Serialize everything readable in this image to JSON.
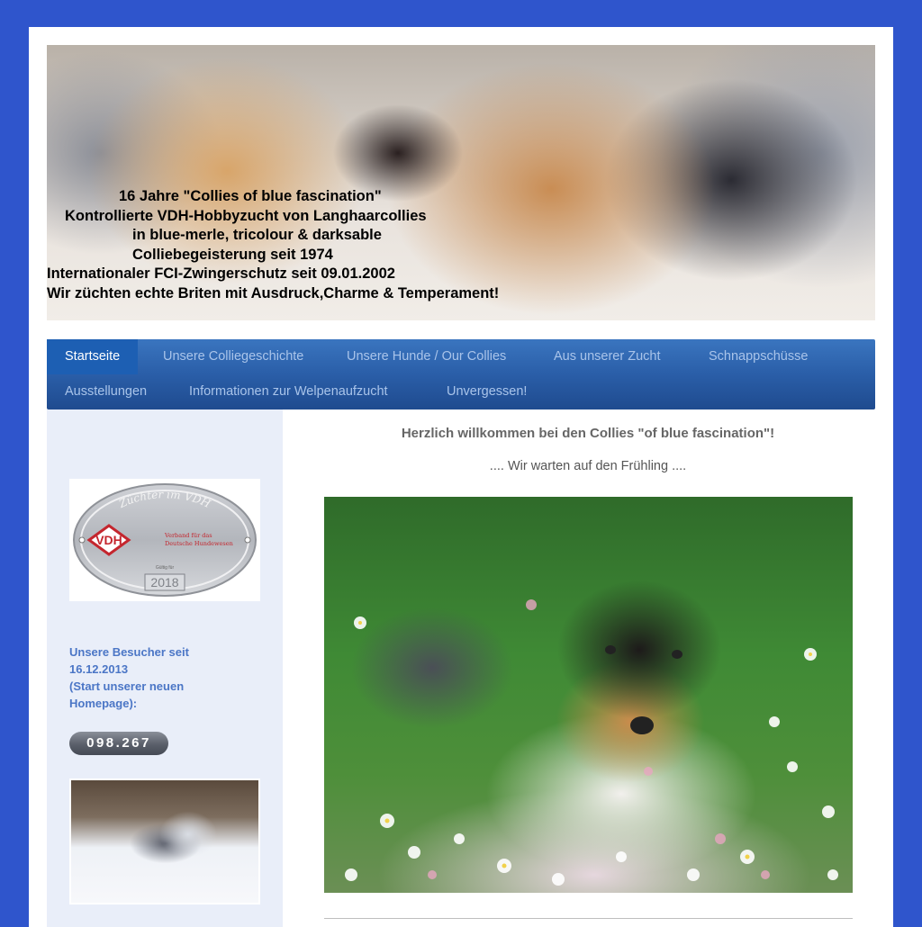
{
  "banner": {
    "lines": [
      "16 Jahre \"Collies of blue fascination\"",
      "Kontrollierte VDH-Hobbyzucht von Langhaarcollies",
      "in blue-merle, tricolour & darksable",
      "Colliebegeisterung seit 1974",
      "Internationaler FCI-Zwingerschutz seit 09.01.2002",
      "Wir züchten echte Briten mit Ausdruck,Charme & Temperament!"
    ]
  },
  "nav": {
    "items": [
      {
        "label": "Startseite",
        "active": true
      },
      {
        "label": "Unsere Colliegeschichte"
      },
      {
        "label": "Unsere Hunde / Our Collies"
      },
      {
        "label": "Aus unserer Zucht"
      },
      {
        "label": "Schnappschüsse"
      },
      {
        "label": "Ausstellungen"
      },
      {
        "label": "Informationen zur Welpenaufzucht"
      },
      {
        "label": "Unvergessen!"
      }
    ]
  },
  "sidebar": {
    "vdh_badge": {
      "arc_text": "Züchter im VDH",
      "logo": "VDH",
      "org_line1": "Verband für das",
      "org_line2": "Deutsche Hundewesen",
      "valid_label": "Gültig für",
      "year": "2018"
    },
    "visitors_label_lines": [
      "Unsere Besucher seit",
      "16.12.2013",
      "(Start unserer neuen",
      "Homepage):"
    ],
    "counter": "098.267"
  },
  "main": {
    "title": "Herzlich willkommen bei den Collies \"of blue fascination\"!",
    "subtitle": ".... Wir warten auf den Frühling ...."
  },
  "colors": {
    "background": "#2f55cc",
    "nav_gradient_top": "#3a75bf",
    "nav_active": "#1d5fb3",
    "sidebar_bg": "#e9eef9",
    "visitors_text": "#4b76c6"
  }
}
